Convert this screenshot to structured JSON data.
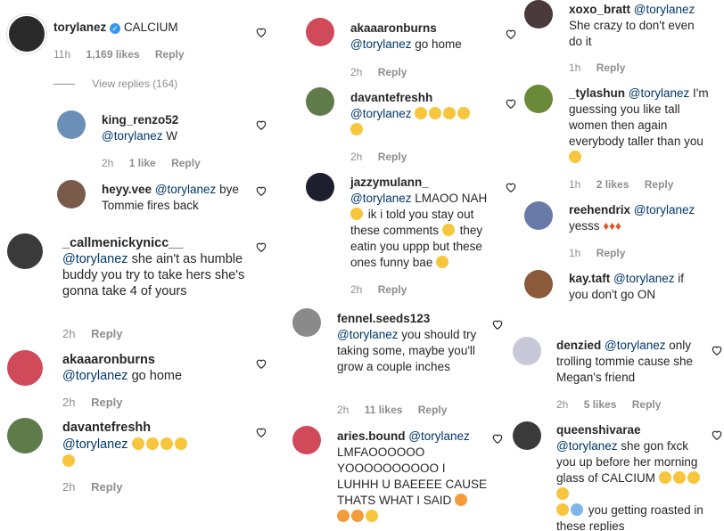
{
  "main_comment": {
    "username": "torylanez",
    "text": "CALCIUM",
    "time": "11h",
    "likes": "1,169 likes",
    "reply": "Reply",
    "view_replies": "View replies (164)"
  },
  "col1": [
    {
      "username": "king_renzo52",
      "mention": "@torylanez",
      "text": "W",
      "time": "2h",
      "likes": "1 like",
      "reply": "Reply"
    },
    {
      "username": "heyy.vee",
      "mention": "@torylanez",
      "text": "bye Tommie fires back",
      "time": "",
      "likes": "",
      "reply": ""
    },
    {
      "username": "_callmenickynicc__",
      "mention": "@torylanez",
      "text": "she ain't as humble buddy you try to take hers she's gonna take 4 of yours",
      "time": "2h",
      "likes": "",
      "reply": "Reply"
    },
    {
      "username": "akaaaronburns",
      "mention": "@torylanez",
      "text": "go home",
      "time": "2h",
      "likes": "",
      "reply": "Reply"
    },
    {
      "username": "davantefreshh",
      "mention": "@torylanez",
      "text": "",
      "time": "2h",
      "likes": "",
      "reply": "Reply"
    }
  ],
  "col2": [
    {
      "username": "akaaaronburns",
      "mention": "@torylanez",
      "text": "go home",
      "time": "2h",
      "likes": "",
      "reply": "Reply"
    },
    {
      "username": "davantefreshh",
      "mention": "@torylanez",
      "text": "",
      "time": "2h",
      "likes": "",
      "reply": "Reply"
    },
    {
      "username": "jazzymulann_",
      "mention": "@torylanez",
      "text": "LMAOO NAH",
      "text2": "ik i told you stay out these comments",
      "text3": "they eatin you uppp but these ones funny bae",
      "time": "2h",
      "likes": "",
      "reply": "Reply"
    },
    {
      "username": "fennel.seeds123",
      "mention": "@torylanez",
      "text": "you should try taking some, maybe you'll grow a couple inches",
      "time": "2h",
      "likes": "11 likes",
      "reply": "Reply"
    },
    {
      "username": "aries.bound",
      "mention": "@torylanez",
      "text": "LMFAOOOOOO YOOOOOOOOOO I LUHHH U BAEEEE CAUSE THATS WHAT I SAID",
      "time": "",
      "likes": "",
      "reply": ""
    }
  ],
  "col3": [
    {
      "username": "xoxo_bratt",
      "mention": "@torylanez",
      "text": "She crazy to don't even do it",
      "time": "1h",
      "likes": "",
      "reply": "Reply"
    },
    {
      "username": "_tylashun",
      "mention": "@torylanez",
      "text": "I'm guessing you like tall women then again everybody taller than you",
      "time": "1h",
      "likes": "2 likes",
      "reply": "Reply"
    },
    {
      "username": "reehendrix",
      "mention": "@torylanez",
      "text": "yesss",
      "time": "1h",
      "likes": "",
      "reply": "Reply"
    },
    {
      "username": "kay.taft",
      "mention": "@torylanez",
      "text": "if you don't go ON somewhere and have a seat",
      "time": "",
      "likes": "",
      "reply": ""
    },
    {
      "username": "denzied",
      "mention": "@torylanez",
      "text": "only trolling tommie cause she Megan's friend",
      "time": "2h",
      "likes": "5 likes",
      "reply": "Reply"
    },
    {
      "username": "queenshivarae",
      "mention": "@torylanez",
      "text": "she gon fxck you up before her morning glass of CALCIUM",
      "text2": "you getting roasted in these replies",
      "time": "",
      "likes": "",
      "reply": ""
    }
  ],
  "colors": {
    "text": "#262626",
    "mention": "#00376b",
    "meta": "#8e8e8e",
    "verified": "#3897f0",
    "emoji": "#f7c63c"
  }
}
